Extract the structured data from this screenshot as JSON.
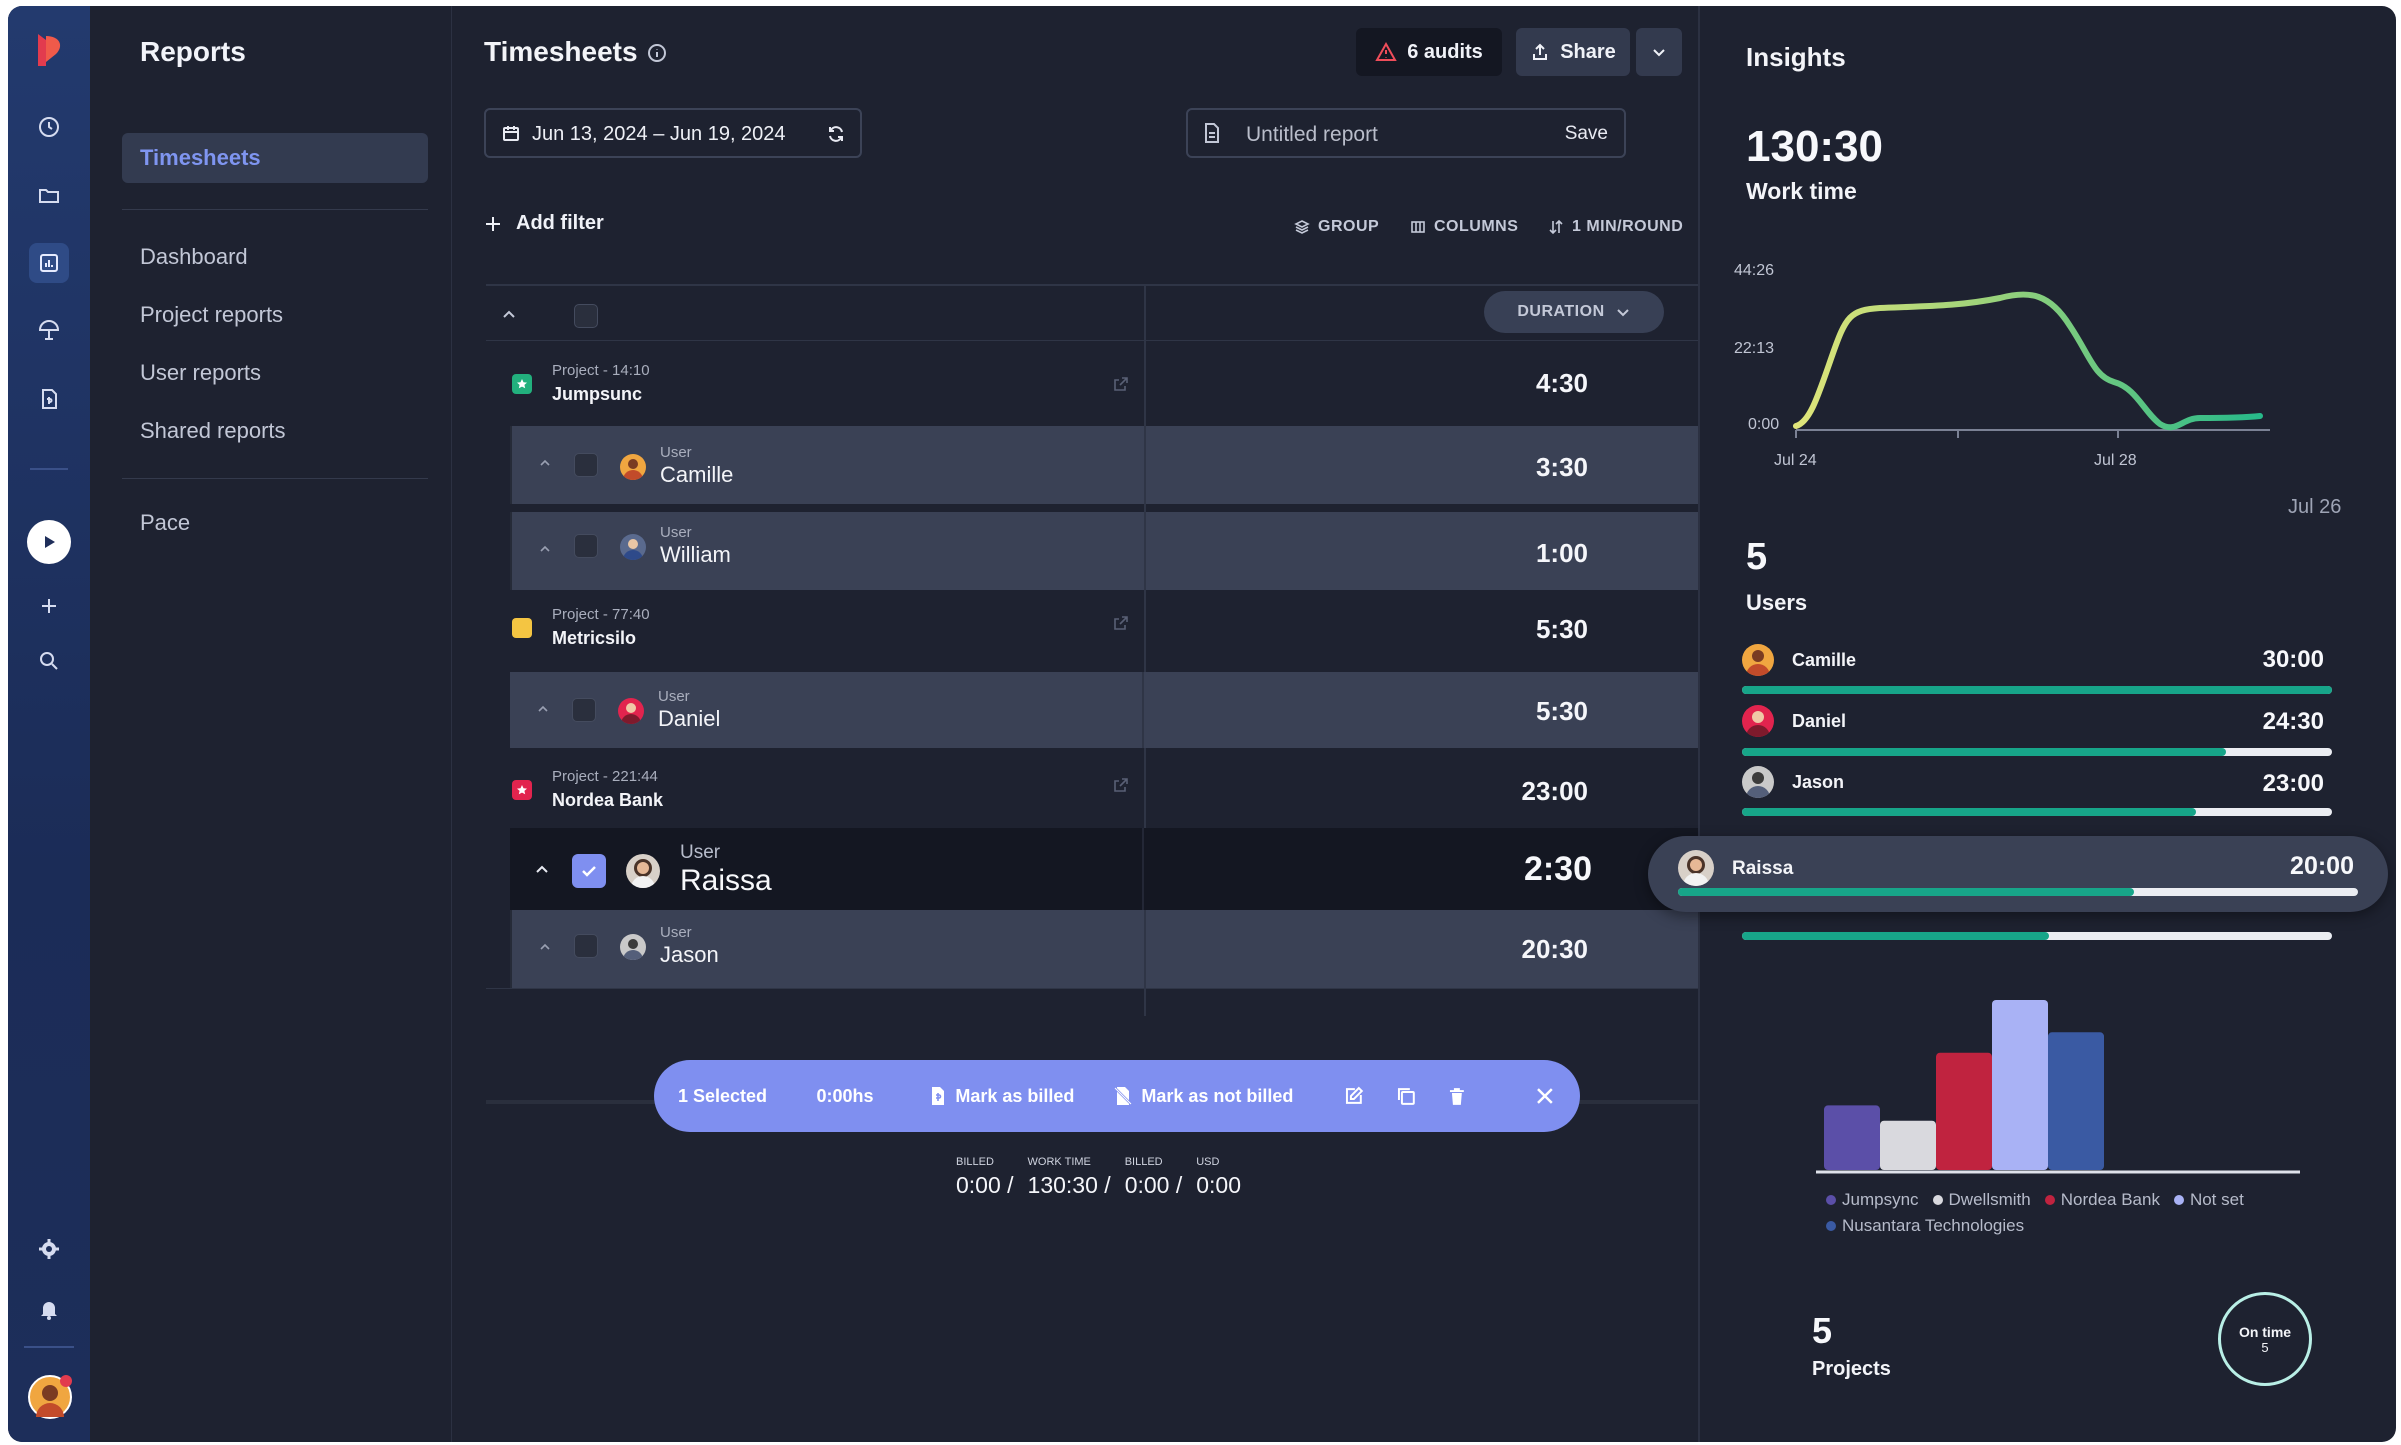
{
  "sidebar": {
    "title": "Reports",
    "active_item": "Timesheets",
    "items": [
      "Dashboard",
      "Project reports",
      "User reports",
      "Shared reports"
    ],
    "pace": "Pace"
  },
  "header": {
    "title": "Timesheets",
    "audits_label": "6 audits",
    "share_label": "Share"
  },
  "date_range": "Jun 13, 2024 – Jun 19, 2024",
  "report": {
    "placeholder": "Untitled report",
    "save_label": "Save"
  },
  "toolbar": {
    "add_filter": "Add filter",
    "group": "GROUP",
    "columns": "COLUMNS",
    "round": "1 MIN/ROUND",
    "duration_header": "DURATION"
  },
  "rows": [
    {
      "type": "project",
      "label": "Project - 14:10",
      "name": "Jumpsunc",
      "duration": "4:30",
      "color": "#22b07d"
    },
    {
      "type": "user",
      "label": "User",
      "name": "Camille",
      "duration": "3:30"
    },
    {
      "type": "user",
      "label": "User",
      "name": "William",
      "duration": "1:00"
    },
    {
      "type": "project",
      "label": "Project - 77:40",
      "name": "Metricsilo",
      "duration": "5:30",
      "color": "#f4c542"
    },
    {
      "type": "user",
      "label": "User",
      "name": "Daniel",
      "duration": "5:30"
    },
    {
      "type": "project",
      "label": "Project - 221:44",
      "name": "Nordea Bank",
      "duration": "23:00",
      "color": "#e2244e"
    },
    {
      "type": "user",
      "label": "User",
      "name": "Raissa",
      "duration": "2:30",
      "selected": true
    },
    {
      "type": "user",
      "label": "User",
      "name": "Jason",
      "duration": "20:30"
    }
  ],
  "selection_bar": {
    "count": "1 Selected",
    "hours": "0:00hs",
    "mark_billed": "Mark as billed",
    "mark_not_billed": "Mark as not billed"
  },
  "totals": [
    {
      "label": "BILLED",
      "value": "0:00 /"
    },
    {
      "label": "WORK TIME",
      "value": "130:30 /"
    },
    {
      "label": "BILLED",
      "value": "0:00 /"
    },
    {
      "label": "USD",
      "value": "0:00"
    }
  ],
  "insights": {
    "title": "Insights",
    "work_time": "130:30",
    "work_time_label": "Work time",
    "chart": {
      "y_ticks": [
        "44:26",
        "22:13",
        "0:00"
      ],
      "x_ticks": [
        "Jul 24",
        "Jul 28"
      ],
      "extra_date": "Jul 26"
    },
    "users_count": "5",
    "users_label": "Users",
    "users": [
      {
        "name": "Camille",
        "time": "30:00",
        "fill": 1.0
      },
      {
        "name": "Daniel",
        "time": "24:30",
        "fill": 0.82
      },
      {
        "name": "Jason",
        "time": "23:00",
        "fill": 0.77
      },
      {
        "name": "Raissa",
        "time": "20:00",
        "fill": 0.67
      },
      {
        "name": "",
        "time": "",
        "fill": 0.52
      }
    ],
    "bar_chart": {
      "legend": [
        {
          "name": "Jumpsync",
          "color": "#5b4fa8"
        },
        {
          "name": "Dwellsmith",
          "color": "#d9d9de"
        },
        {
          "name": "Nordea Bank",
          "color": "#c0233f"
        },
        {
          "name": "Not set",
          "color": "#a9b2f5"
        },
        {
          "name": "Nusantara Technologies",
          "color": "#3a5aa3"
        }
      ],
      "values": [
        0.38,
        0.29,
        0.69,
        1.0,
        0.81
      ]
    },
    "projects_count": "5",
    "projects_label": "Projects",
    "on_time_label": "On time",
    "on_time_value": "5"
  }
}
